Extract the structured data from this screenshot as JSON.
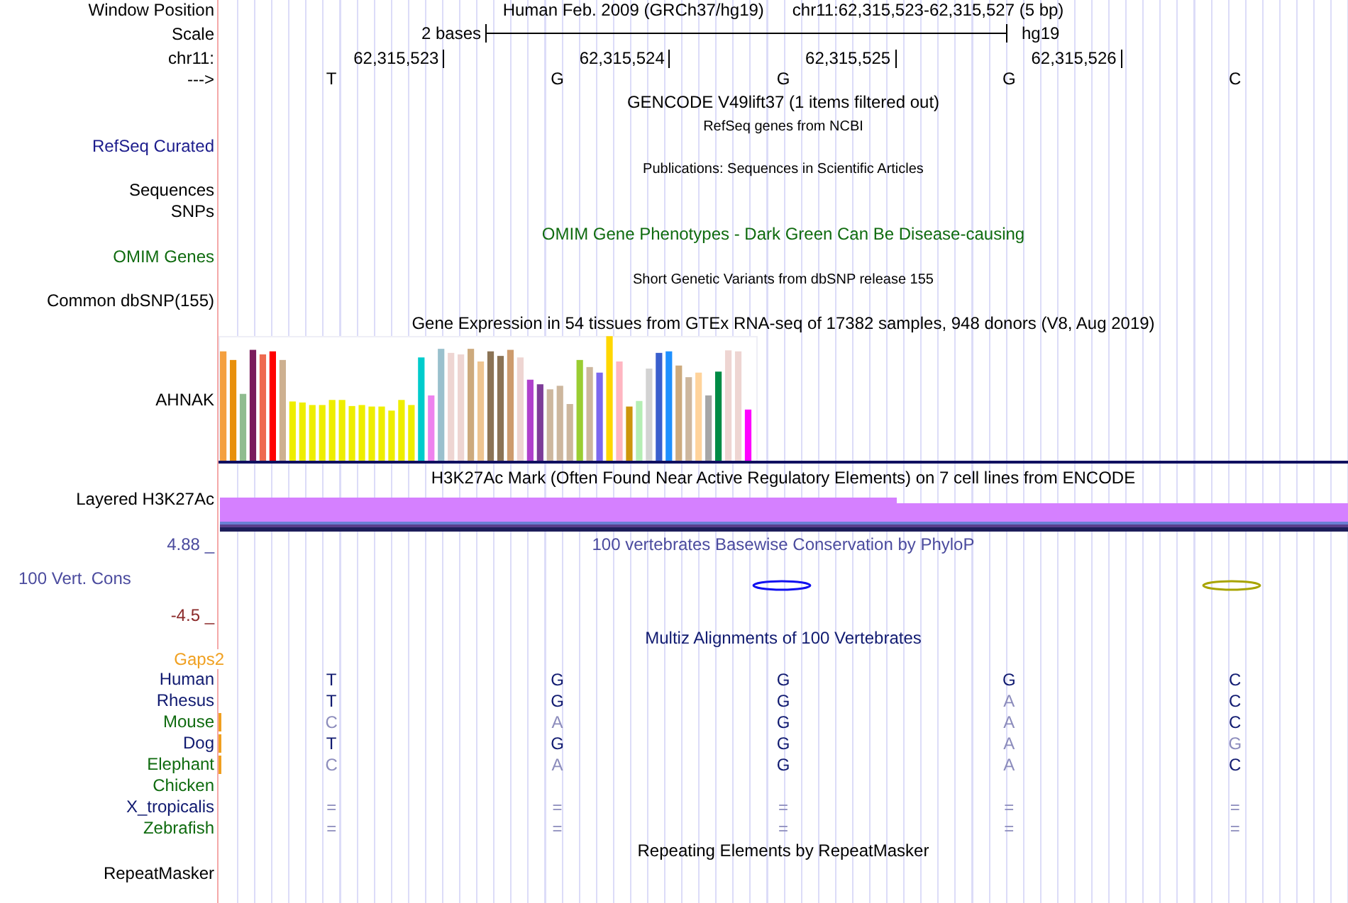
{
  "header": {
    "window_label": "Window Position",
    "assembly": "Human Feb. 2009 (GRCh37/hg19)",
    "position": "chr11:62,315,523-62,315,527 (5 bp)",
    "scale_label": "Scale",
    "scale_text": "2 bases",
    "scale_db": "hg19",
    "chrom_label": "chr11:",
    "ticks": [
      "62,315,523",
      "62,315,524",
      "62,315,525",
      "62,315,526"
    ],
    "strand_label": "--->",
    "bases": [
      "T",
      "G",
      "G",
      "G",
      "C"
    ]
  },
  "tracks": [
    {
      "kind": "title_only",
      "title": "GENCODE V49lift37 (1 items filtered out)",
      "color": "#000000"
    },
    {
      "kind": "small",
      "title": "RefSeq genes from NCBI",
      "color": "#000000",
      "labels": [
        {
          "text": "RefSeq Curated",
          "color": "#1c1c8c"
        }
      ]
    },
    {
      "kind": "small",
      "title": "Publications: Sequences in Scientific Articles",
      "color": "#000000",
      "labels": [
        {
          "text": "Sequences",
          "color": "#000000"
        },
        {
          "text": "SNPs",
          "color": "#000000"
        }
      ]
    },
    {
      "kind": "normal",
      "title": "OMIM Gene Phenotypes - Dark Green Can Be Disease-causing",
      "color": "#0f6b0f",
      "labels": [
        {
          "text": "OMIM Genes",
          "color": "#0f6b0f"
        }
      ]
    },
    {
      "kind": "small",
      "title": "Short Genetic Variants from dbSNP release 155",
      "color": "#000000",
      "labels": [
        {
          "text": "Common dbSNP(155)",
          "color": "#000000"
        }
      ]
    },
    {
      "kind": "bar_chart",
      "title": "Gene Expression in 54 tissues from GTEx RNA-seq of 17382 samples, 948 donors (V8, Aug 2019)",
      "color": "#000000",
      "labels": [
        {
          "text": "AHNAK",
          "color": "#000000"
        }
      ]
    },
    {
      "kind": "layered",
      "title": "H3K27Ac Mark (Often Found Near Active Regulatory Elements) on 7 cell lines from ENCODE",
      "color": "#000000",
      "labels": [
        {
          "text": "Layered H3K27Ac",
          "color": "#000000"
        }
      ]
    },
    {
      "kind": "wiggle",
      "title": "100 vertebrates Basewise Conservation by PhyloP",
      "color": "#4b4b9e",
      "labels": [
        {
          "text": "100 Vert. Cons",
          "color": "#4b4b9e"
        }
      ],
      "max_label": "4.88 _",
      "min_label": "-4.5 _"
    },
    {
      "kind": "alignment",
      "title": "Multiz Alignments of 100 Vertebrates",
      "color": "#101a70",
      "gaps_label": "Gaps2",
      "species": [
        {
          "name": "Human",
          "color": "#101a70",
          "gap_mark": false,
          "bases": [
            {
              "text": "T",
              "match": true
            },
            {
              "text": "G",
              "match": true
            },
            {
              "text": "G",
              "match": true
            },
            {
              "text": "G",
              "match": true
            },
            {
              "text": "C",
              "match": true
            }
          ]
        },
        {
          "name": "Rhesus",
          "color": "#101a70",
          "gap_mark": false,
          "bases": [
            {
              "text": "T",
              "match": true
            },
            {
              "text": "G",
              "match": true
            },
            {
              "text": "G",
              "match": true
            },
            {
              "text": "A",
              "match": false
            },
            {
              "text": "C",
              "match": true
            }
          ]
        },
        {
          "name": "Mouse",
          "color": "#0f6b0f",
          "gap_mark": true,
          "bases": [
            {
              "text": "C",
              "match": false
            },
            {
              "text": "A",
              "match": false
            },
            {
              "text": "G",
              "match": true
            },
            {
              "text": "A",
              "match": false
            },
            {
              "text": "C",
              "match": true
            }
          ]
        },
        {
          "name": "Dog",
          "color": "#101a70",
          "gap_mark": true,
          "bases": [
            {
              "text": "T",
              "match": true
            },
            {
              "text": "G",
              "match": true
            },
            {
              "text": "G",
              "match": true
            },
            {
              "text": "A",
              "match": false
            },
            {
              "text": "G",
              "match": false
            }
          ]
        },
        {
          "name": "Elephant",
          "color": "#0f6b0f",
          "gap_mark": true,
          "bases": [
            {
              "text": "C",
              "match": false
            },
            {
              "text": "A",
              "match": false
            },
            {
              "text": "G",
              "match": true
            },
            {
              "text": "A",
              "match": false
            },
            {
              "text": "C",
              "match": true
            }
          ]
        },
        {
          "name": "Chicken",
          "color": "#0f6b0f",
          "gap_mark": false
        },
        {
          "name": "X_tropicalis",
          "color": "#101a70",
          "gap_mark": false,
          "bases": [
            {
              "text": "=",
              "match": false
            },
            {
              "text": "=",
              "match": false
            },
            {
              "text": "=",
              "match": false
            },
            {
              "text": "=",
              "match": false
            },
            {
              "text": "=",
              "match": false
            }
          ]
        },
        {
          "name": "Zebrafish",
          "color": "#0f6b0f",
          "gap_mark": false,
          "bases": [
            {
              "text": "=",
              "match": false
            },
            {
              "text": "=",
              "match": false
            },
            {
              "text": "=",
              "match": false
            },
            {
              "text": "=",
              "match": false
            },
            {
              "text": "=",
              "match": false
            }
          ]
        }
      ]
    },
    {
      "kind": "normal",
      "title": "Repeating Elements by RepeatMasker",
      "color": "#000000",
      "labels": [
        {
          "text": "RepeatMasker",
          "color": "#000000"
        }
      ]
    }
  ]
}
